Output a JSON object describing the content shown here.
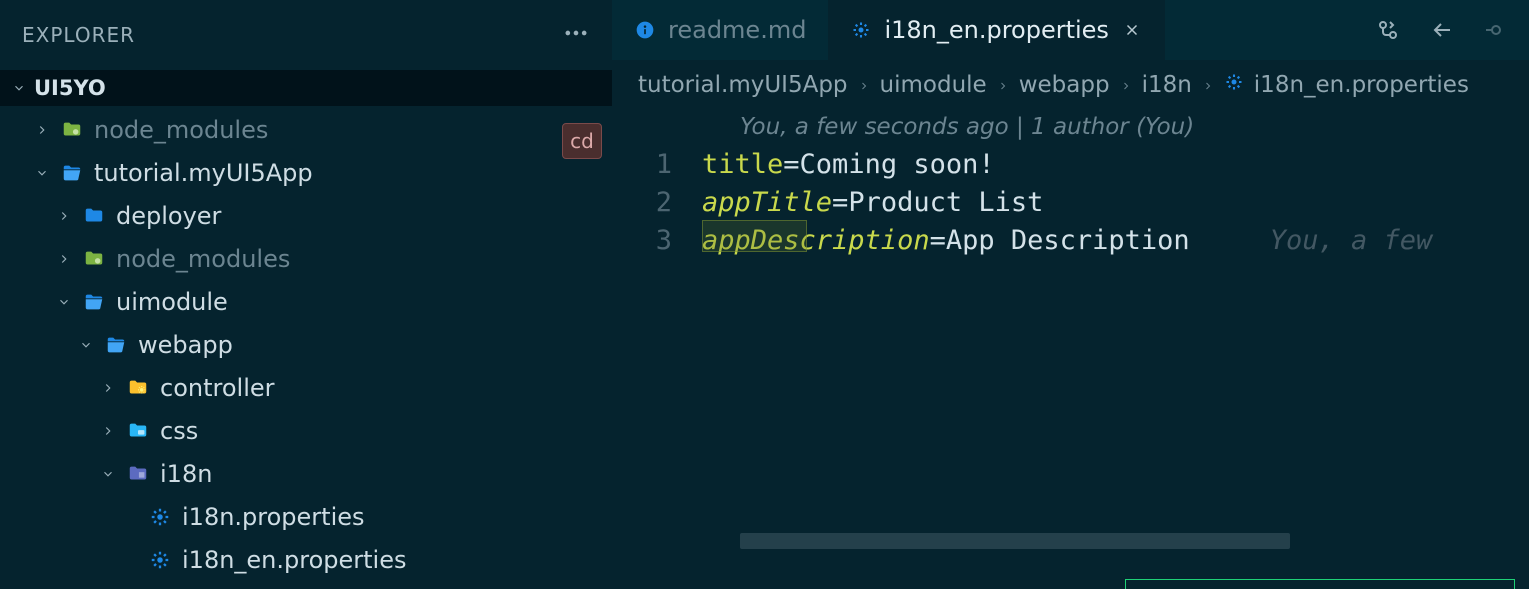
{
  "sidebar": {
    "title": "EXPLORER",
    "root": "UI5YO",
    "cd_badge": "cd",
    "items": [
      {
        "label": "node_modules",
        "icon": "folder-green",
        "twisty": "right",
        "indent": 0,
        "dim": true
      },
      {
        "label": "tutorial.myUI5App",
        "icon": "folder-open",
        "twisty": "down",
        "indent": 0,
        "dim": false
      },
      {
        "label": "deployer",
        "icon": "folder",
        "twisty": "right",
        "indent": 1,
        "dim": false
      },
      {
        "label": "node_modules",
        "icon": "folder-green",
        "twisty": "right",
        "indent": 1,
        "dim": true
      },
      {
        "label": "uimodule",
        "icon": "folder-open",
        "twisty": "down",
        "indent": 1,
        "dim": false
      },
      {
        "label": "webapp",
        "icon": "folder-open",
        "twisty": "down",
        "indent": 2,
        "dim": false
      },
      {
        "label": "controller",
        "icon": "folder-gear",
        "twisty": "right",
        "indent": 3,
        "dim": false
      },
      {
        "label": "css",
        "icon": "folder-css",
        "twisty": "right",
        "indent": 3,
        "dim": false
      },
      {
        "label": "i18n",
        "icon": "folder-i18n",
        "twisty": "down",
        "indent": 3,
        "dim": false
      },
      {
        "label": "i18n.properties",
        "icon": "gear-blue",
        "twisty": "",
        "indent": 4,
        "dim": false
      },
      {
        "label": "i18n_en.properties",
        "icon": "gear-blue",
        "twisty": "",
        "indent": 4,
        "dim": false
      }
    ]
  },
  "tabs": [
    {
      "label": "readme.md",
      "icon": "info-blue",
      "active": false,
      "close": false
    },
    {
      "label": "i18n_en.properties",
      "icon": "gear-blue",
      "active": true,
      "close": true
    }
  ],
  "breadcrumb": {
    "segments": [
      "tutorial.myUI5App",
      "uimodule",
      "webapp",
      "i18n"
    ],
    "file_icon": "gear-blue",
    "file": "i18n_en.properties"
  },
  "codelens": "You, a few seconds ago | 1 author (You)",
  "code": {
    "lines": [
      {
        "n": "1",
        "key": "title",
        "keyStyle": "key",
        "val": "Coming soon!"
      },
      {
        "n": "2",
        "key": "appTitle",
        "keyStyle": "key-italic",
        "val": "Product List"
      },
      {
        "n": "3",
        "key": "appDescription",
        "keyStyle": "key-italic",
        "val": "App Description",
        "inline": "You, a few"
      }
    ]
  }
}
